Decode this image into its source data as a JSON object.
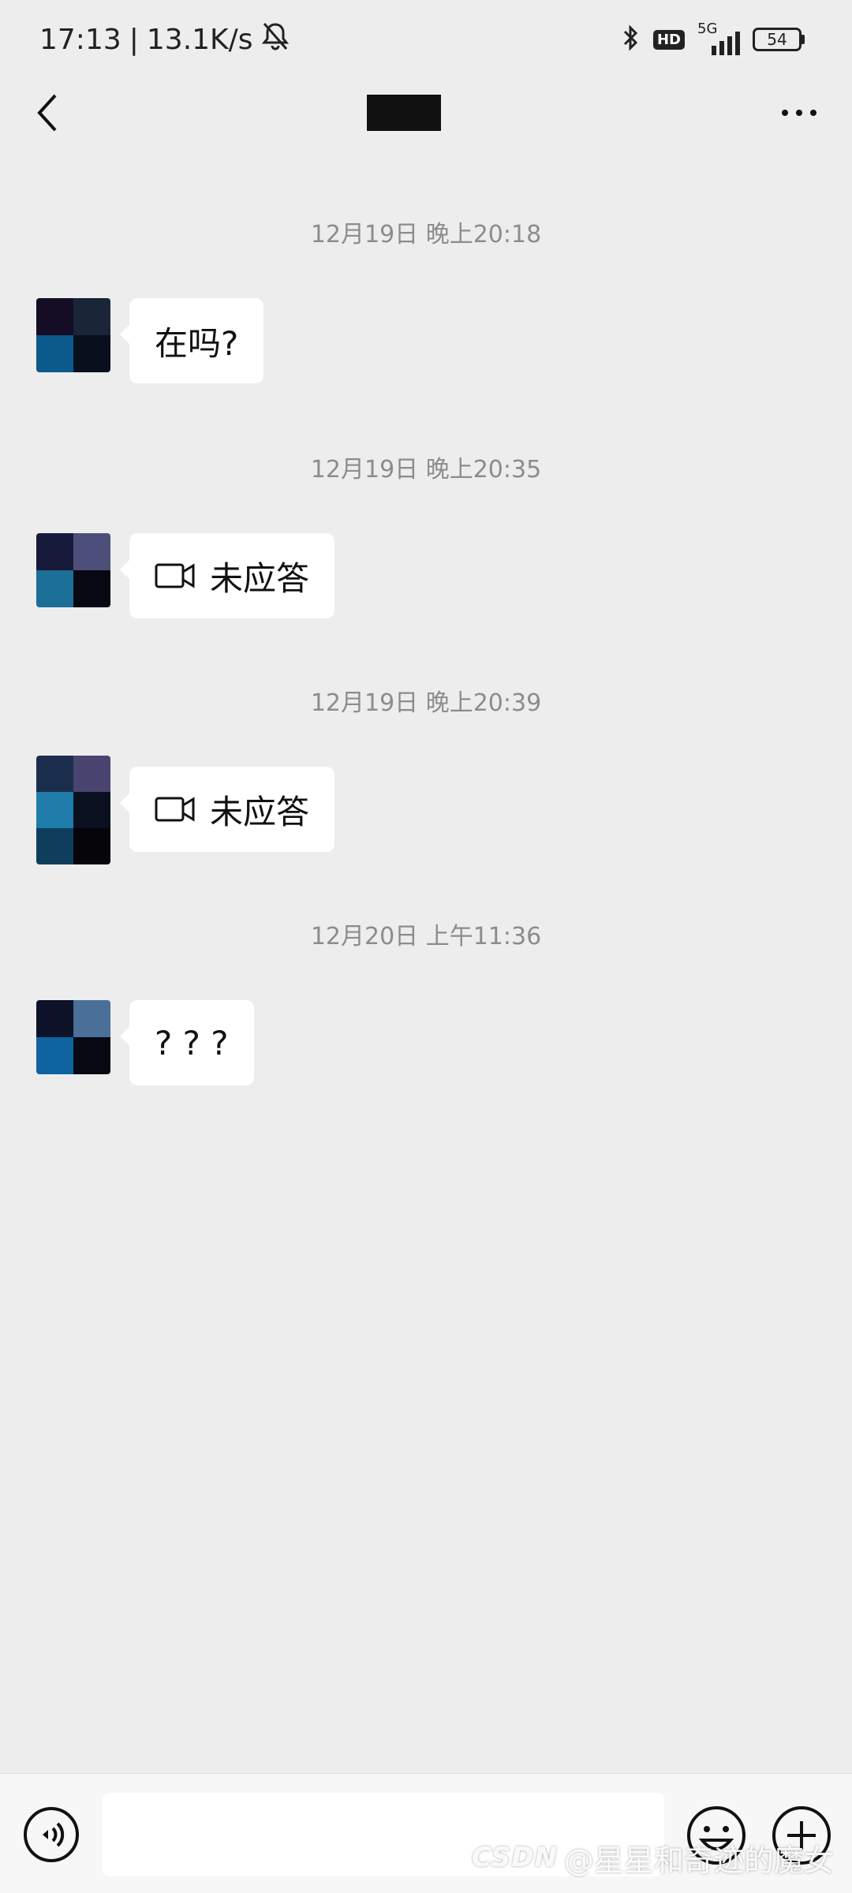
{
  "status_bar": {
    "time": "17:13",
    "separator": "|",
    "network_speed": "13.1K/s",
    "network_type": "5G",
    "hd_badge": "HD",
    "battery": "54"
  },
  "nav": {
    "title": ""
  },
  "messages": [
    {
      "timestamp": "12月19日 晚上20:18",
      "text": "在吗?",
      "type": "text"
    },
    {
      "timestamp": "12月19日 晚上20:35",
      "text": "未应答",
      "type": "video-call"
    },
    {
      "timestamp": "12月19日 晚上20:39",
      "text": "未应答",
      "type": "video-call"
    },
    {
      "timestamp": "12月20日 上午11:36",
      "text": "? ? ?",
      "type": "text"
    }
  ],
  "avatars": [
    [
      "#140d24",
      "#1a2538",
      "#0c5a8c",
      "#0a0f1e"
    ],
    [
      "#171a3a",
      "#4d4f7a",
      "#1c6f96",
      "#080812"
    ],
    [
      "#1c2e4e",
      "#4a4470",
      "#1f7cab",
      "#0a1020",
      "#0e3e5c",
      "#05050a"
    ],
    [
      "#0d1228",
      "#4a6f98",
      "#0d64a0",
      "#080812"
    ]
  ],
  "input": {
    "placeholder": ""
  },
  "watermark": {
    "logo": "CSDN",
    "text": "@星星和奇迹的魔女"
  },
  "colors": {
    "background": "#ededed",
    "bubble": "#ffffff",
    "timestamp": "#8c8c8c"
  }
}
